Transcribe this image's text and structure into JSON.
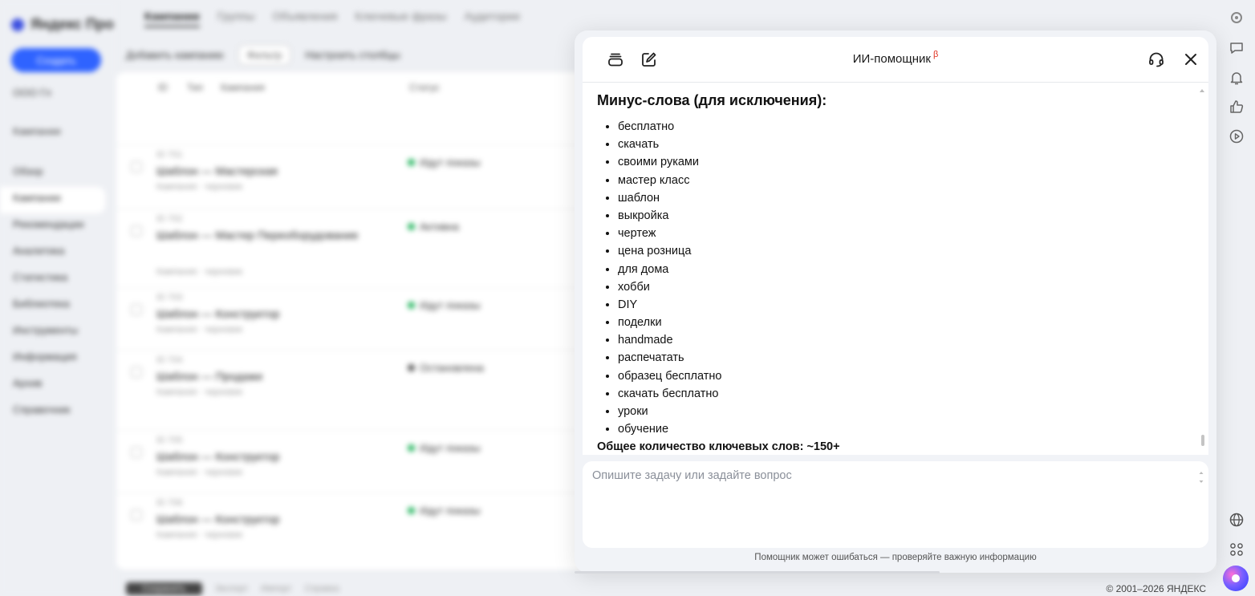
{
  "background": {
    "logo": "Яндекс Про",
    "create_button": "Создать",
    "account_label": "ООО Гл",
    "budget_label": "Кампании",
    "nav_items": [
      "Обзор",
      "Кампании",
      "Рекомендации",
      "Аналитика",
      "Статистика",
      "Библиотека",
      "Инструменты",
      "Информация",
      "Архив",
      "Справочник"
    ],
    "tabs": [
      "Кампании",
      "Группы",
      "Объявления",
      "Ключевые фразы",
      "Аудитории"
    ],
    "toolbar": [
      "Добавить кампанию",
      "Фильтр",
      "Настроить столбцы"
    ],
    "table_headers": [
      "ID",
      "Тип",
      "Кампания",
      "Статус"
    ],
    "rows": [
      {
        "id": "ID 701",
        "name": "Шаблон — Мастерская",
        "sub": "Кампания · черновик",
        "status": "Идут показы"
      },
      {
        "id": "ID 702",
        "name": "Шаблон — Мастер Переоборудование",
        "sub": "Кампания · черновик",
        "status": "Активна"
      },
      {
        "id": "ID 703",
        "name": "Шаблон — Конструктор",
        "sub": "Кампания · черновик",
        "status": "Идут показы"
      },
      {
        "id": "ID 704",
        "name": "Шаблон — Продажи",
        "sub": "Кампания · черновик",
        "status": "Остановлена"
      },
      {
        "id": "ID 705",
        "name": "Шаблон — Конструктор",
        "sub": "Кампания · черновик",
        "status": "Идут показы"
      },
      {
        "id": "ID 706",
        "name": "Шаблон — Конструктор",
        "sub": "Кампания · черновик",
        "status": "Идут показы"
      }
    ],
    "footer_links": [
      "Сохранить",
      "Экспорт",
      "Импорт",
      "Справка"
    ]
  },
  "assistant": {
    "title": "ИИ-помощник",
    "beta_mark": "β",
    "section_heading": "Минус-слова (для исключения):",
    "minus_words": [
      "бесплатно",
      "скачать",
      "своими руками",
      "мастер класс",
      "шаблон",
      "выкройка",
      "чертеж",
      "цена розница",
      "для дома",
      "хобби",
      "DIY",
      "поделки",
      "handmade",
      "распечатать",
      "образец бесплатно",
      "скачать бесплатно",
      "уроки",
      "обучение"
    ],
    "total_line": "Общее количество ключевых слов: ~150+",
    "input_placeholder": "Опишите задачу или задайте вопрос",
    "input_value": "",
    "disclaimer": "Помощник может ошибаться — проверяйте важную информацию"
  },
  "icons": {
    "history": "history-icon",
    "new_chat": "edit-icon",
    "support": "headset-icon",
    "close": "close-icon"
  },
  "rail_icons": [
    "settings-icon",
    "chat-icon",
    "bell-icon",
    "thumbs-up-icon",
    "play-icon",
    "globe-icon",
    "grid-icon",
    "alice-icon"
  ],
  "copyright": "© 2001–2026 ЯНДЕКС",
  "colors": {
    "accent": "#2f63ff",
    "beta": "#e0301e",
    "status_ok": "#1fb25a"
  }
}
